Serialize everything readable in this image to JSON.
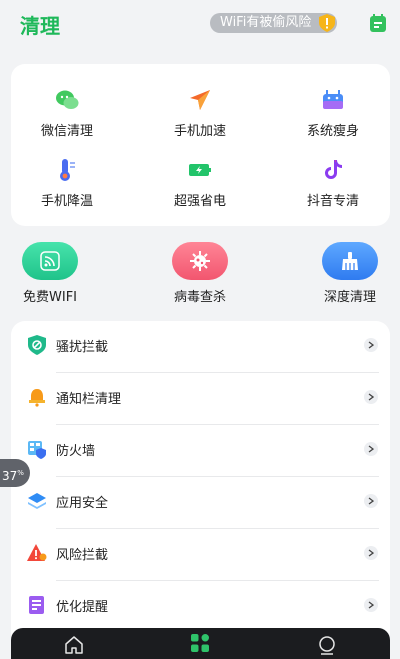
{
  "header": {
    "title": "清理",
    "wifi_warning": "WiFi有被偷风险"
  },
  "tools": [
    {
      "label": "微信清理",
      "icon": "wechat-icon"
    },
    {
      "label": "手机加速",
      "icon": "rocket-icon"
    },
    {
      "label": "系统瘦身",
      "icon": "android-icon"
    },
    {
      "label": "手机降温",
      "icon": "thermometer-icon"
    },
    {
      "label": "超强省电",
      "icon": "battery-icon"
    },
    {
      "label": "抖音专清",
      "icon": "tiktok-icon"
    }
  ],
  "actions": [
    {
      "label": "免费WIFI",
      "icon": "wifi-icon",
      "color": "#2fd59a"
    },
    {
      "label": "病毒查杀",
      "icon": "virus-icon",
      "color": "#f7607a"
    },
    {
      "label": "深度清理",
      "icon": "broom-icon",
      "color": "#3d8ff5"
    }
  ],
  "list": [
    {
      "label": "骚扰拦截",
      "icon": "shield-block-icon"
    },
    {
      "label": "通知栏清理",
      "icon": "bell-icon"
    },
    {
      "label": "防火墙",
      "icon": "firewall-icon"
    },
    {
      "label": "应用安全",
      "icon": "layers-icon"
    },
    {
      "label": "风险拦截",
      "icon": "warning-icon"
    },
    {
      "label": "优化提醒",
      "icon": "document-icon"
    }
  ],
  "float_bubble": {
    "value": "37",
    "unit": "%"
  },
  "colors": {
    "brand": "#1fb85a",
    "nav_active": "#2fc36a"
  }
}
